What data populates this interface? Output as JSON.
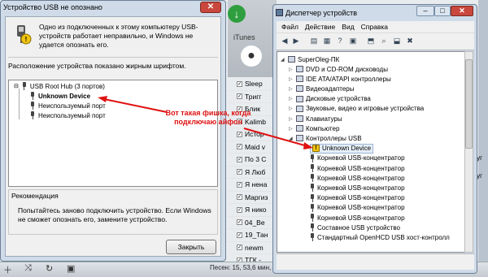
{
  "dialog": {
    "title": "Устройство USB не опознано",
    "message": "Одно из подключенных к этому компьютеру USB-устройств работает неправильно, и Windows не удается опознать его.",
    "location_label": "Расположение устройства показано жирным шрифтом.",
    "tree": {
      "root": "USB Root Hub (3 портов)",
      "items": [
        "Unknown Device",
        "Неиспользуемый порт",
        "Неиспользуемый порт"
      ]
    },
    "recommendation_title": "Рекомендация",
    "recommendation_text": "Попытайтесь заново подключить устройство. Если Windows не сможет опознать его, замените устройство.",
    "close_button": "Закрыть"
  },
  "annotation": "Вот такая фишка, когда подключаю айфон",
  "device_manager": {
    "title": "Диспетчер устройств",
    "menu": [
      "Файл",
      "Действие",
      "Вид",
      "Справка"
    ],
    "computer": "SuperOleg-ПК",
    "categories": [
      "DVD и CD-ROM дисководы",
      "IDE ATA/ATAPI контроллеры",
      "Видеоадаптеры",
      "Дисковые устройства",
      "Звуковые, видео и игровые устройства",
      "Клавиатуры",
      "Компьютер",
      "Контроллеры USB"
    ],
    "usb_children": [
      "Unknown Device",
      "Корневой USB-концентратор",
      "Корневой USB-концентратор",
      "Корневой USB-концентратор",
      "Корневой USB-концентратор",
      "Корневой USB-концентратор",
      "Корневой USB-концентратор",
      "Корневой USB-концентратор",
      "Составное USB устройство",
      "Стандартный OpenHCD USB хост-контролл"
    ]
  },
  "itunes": {
    "label": "iTunes",
    "songs": [
      "Sleep",
      "Тригг",
      "Блик",
      "Kalimb",
      "Истор",
      "Maid v",
      "По 3 С",
      "Я Люб",
      "Я нена",
      "Маргиз",
      "Я нико",
      "04_Ве",
      "19_Тан",
      "newm",
      "ТГК -"
    ],
    "status": "Песен: 15, 53,6 мин, 10",
    "side_text": [
      "Округ",
      "Округ"
    ]
  },
  "colors": {
    "annotation": "#e01212",
    "warning": "#f1c40f"
  }
}
